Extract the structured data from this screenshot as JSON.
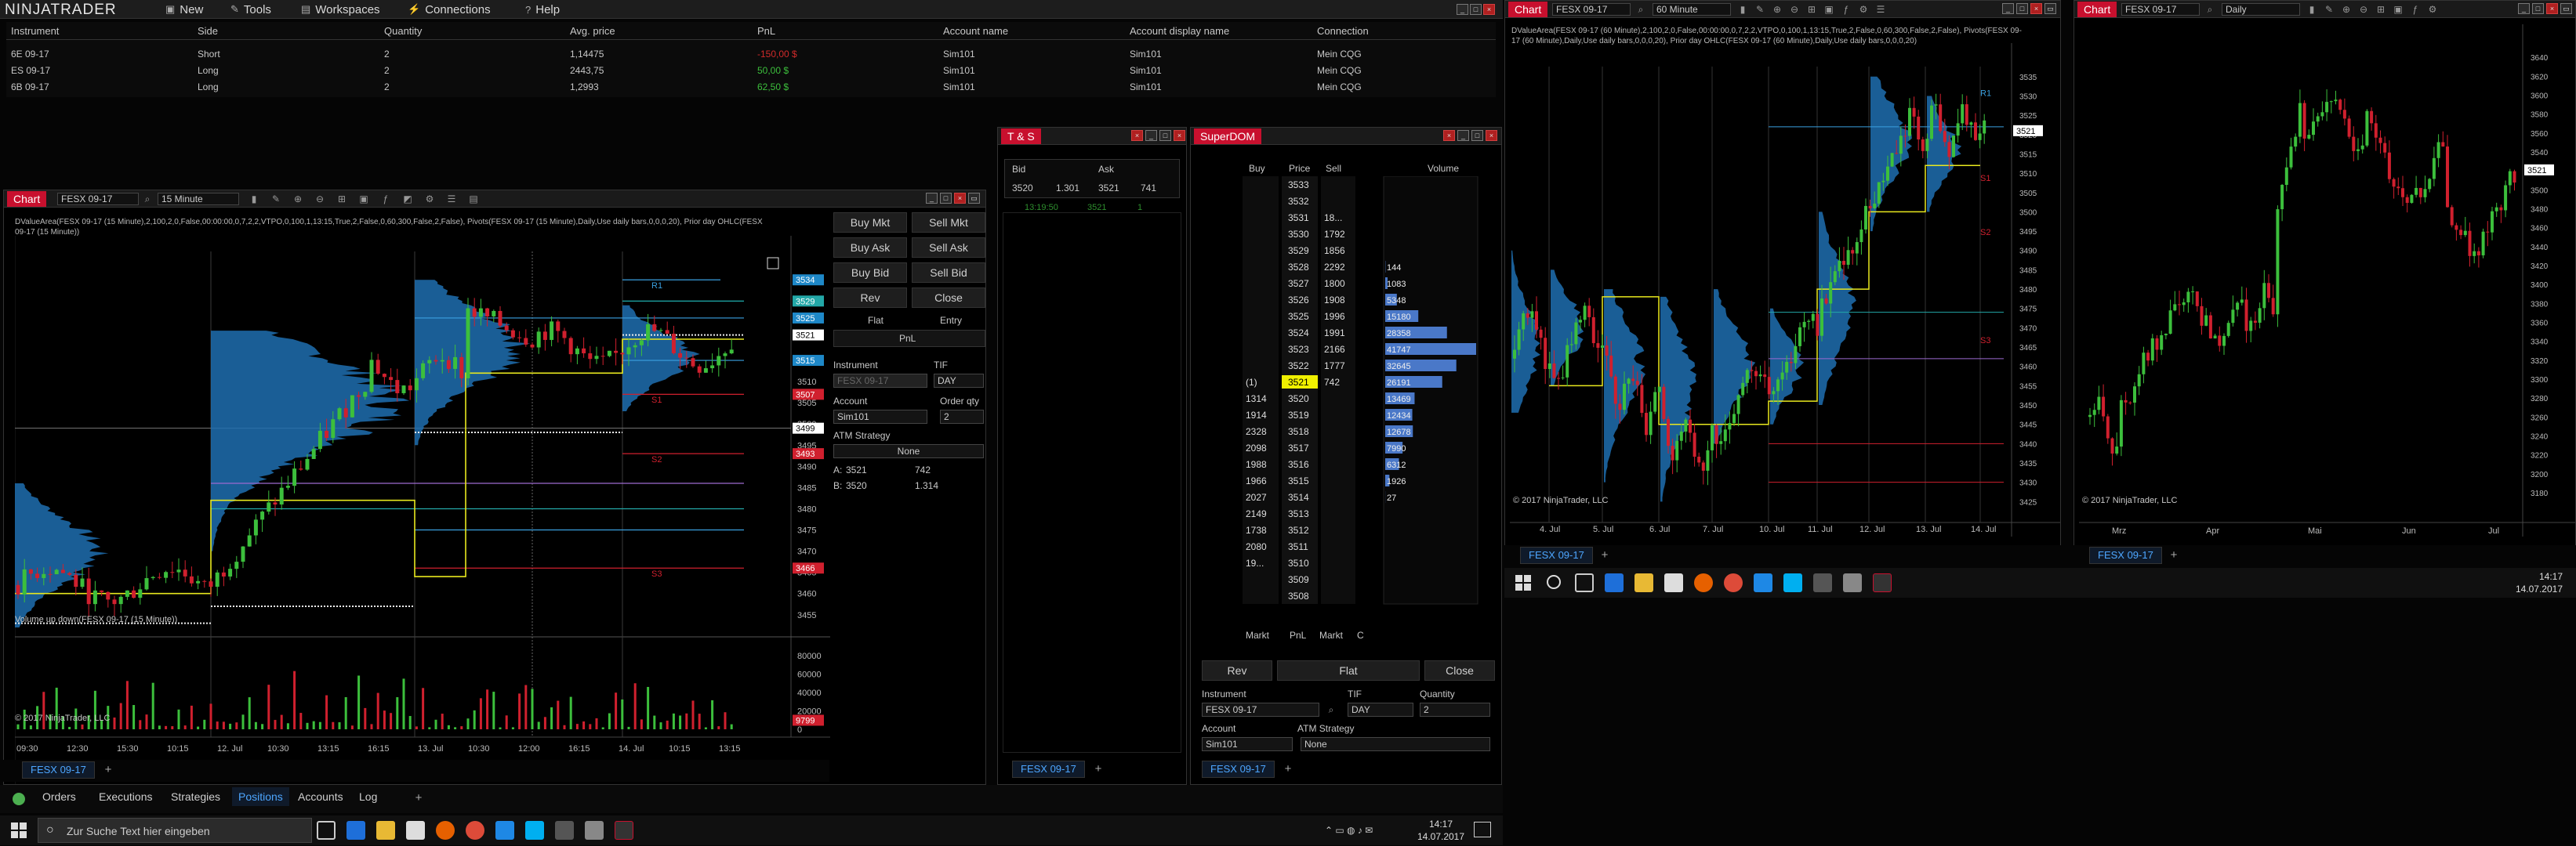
{
  "app": {
    "logo": "NINJATRADER"
  },
  "menu": {
    "items": [
      "New",
      "Tools",
      "Workspaces",
      "Connections",
      "Help"
    ]
  },
  "positions": {
    "columns": [
      "Instrument",
      "Side",
      "Quantity",
      "Avg. price",
      "PnL",
      "Account name",
      "Account display name",
      "Connection"
    ],
    "rows": [
      {
        "instrument": "6E 09-17",
        "side": "Short",
        "qty": "2",
        "avg": "1,14475",
        "pnl": "-150,00 $",
        "account": "Sim101",
        "display": "Sim101",
        "conn": "Mein CQG"
      },
      {
        "instrument": "ES 09-17",
        "side": "Long",
        "qty": "2",
        "avg": "2443,75",
        "pnl": "50,00 $",
        "account": "Sim101",
        "display": "Sim101",
        "conn": "Mein CQG"
      },
      {
        "instrument": "6B 09-17",
        "side": "Long",
        "qty": "2",
        "avg": "1,2993",
        "pnl": "62,50 $",
        "account": "Sim101",
        "display": "Sim101",
        "conn": "Mein CQG"
      }
    ]
  },
  "chart_main": {
    "title": "Chart",
    "instrument": "FESX 09-17",
    "interval": "15 Minute",
    "indicator_text": "DValueArea(FESX 09-17 (15 Minute),2,100,2,0,False,00:00:00,0,7,2,2,VTPO,0,100,1,13:15,True,2,False,0,60,300,False,2,False), Pivots(FESX 09-17 (15 Minute),Daily,Use daily bars,0,0,0,20), Prior day OHLC(FESX 09-17 (15 Minute))",
    "volume_label": "Volume up down(FESX 09-17 (15 Minute))",
    "copyright": "© 2017 NinjaTrader, LLC",
    "price_ticks": [
      "3515",
      "3510",
      "3505",
      "3500",
      "3495",
      "3490",
      "3485",
      "3480",
      "3475",
      "3470",
      "3465",
      "3460",
      "3455"
    ],
    "price_tags": [
      {
        "label": "3534",
        "color": "#1e88c8"
      },
      {
        "label": "3529",
        "color": "#23a8a8"
      },
      {
        "label": "3525",
        "color": "#1e88c8"
      },
      {
        "label": "3521",
        "color": "#ffffff"
      },
      {
        "label": "3515",
        "color": "#1e88c8"
      },
      {
        "label": "3507",
        "color": "#d0202e"
      },
      {
        "label": "3499",
        "color": "#ffffff"
      },
      {
        "label": "3493",
        "color": "#d0202e"
      },
      {
        "label": "3466",
        "color": "#d0202e"
      }
    ],
    "pivot_labels": [
      "R1",
      "S1",
      "S2",
      "S3"
    ],
    "vol_ticks": [
      "80000",
      "60000",
      "40000",
      "20000",
      "0"
    ],
    "vol_tag": "9799",
    "time_ticks": [
      "09:30",
      "12:30",
      "15:30",
      "10:15",
      "12. Jul",
      "10:30",
      "13:15",
      "16:15",
      "13. Jul",
      "10:30",
      "12:00",
      "16:15",
      "14. Jul",
      "10:15",
      "13:15"
    ],
    "tab": "FESX 09-17"
  },
  "chart_trader": {
    "buy_mkt": "Buy Mkt",
    "sell_mkt": "Sell Mkt",
    "buy_ask": "Buy Ask",
    "sell_ask": "Sell Ask",
    "buy_bid": "Buy Bid",
    "sell_bid": "Sell Bid",
    "rev": "Rev",
    "close": "Close",
    "flat": "Flat",
    "entry": "Entry",
    "pnl": "PnL",
    "instrument_label": "Instrument",
    "instrument_value": "FESX 09-17",
    "tif_label": "TIF",
    "tif_value": "DAY",
    "account_label": "Account",
    "account_value": "Sim101",
    "order_qty_label": "Order qty",
    "order_qty_value": "2",
    "atm_label": "ATM Strategy",
    "atm_value": "None",
    "ask_line_label": "A:",
    "ask_price": "3521",
    "ask_size": "742",
    "bid_line_label": "B:",
    "bid_price": "3520",
    "bid_size": "1.314"
  },
  "ts": {
    "title": "T & S",
    "bid_label": "Bid",
    "ask_label": "Ask",
    "bid_price": "3520",
    "bid_size": "1.301",
    "ask_price": "3521",
    "ask_size": "741",
    "trade_time": "13:19:50",
    "trade_price": "3521",
    "trade_size": "1",
    "tab": "FESX 09-17"
  },
  "superdom": {
    "title": "SuperDOM",
    "col_buy": "Buy",
    "col_price": "Price",
    "col_sell": "Sell",
    "col_volume": "Volume",
    "prices": [
      "3533",
      "3532",
      "3531",
      "3530",
      "3529",
      "3528",
      "3527",
      "3526",
      "3525",
      "3524",
      "3523",
      "3522",
      "3521",
      "3520",
      "3519",
      "3518",
      "3517",
      "3516",
      "3515",
      "3514",
      "3513",
      "3512",
      "3511",
      "3510",
      "3509",
      "3508"
    ],
    "sells": [
      "",
      "",
      "18...",
      "1792",
      "1856",
      "2292",
      "1800",
      "1908",
      "1996",
      "1991",
      "2166",
      "1777",
      "742",
      "",
      "",
      "",
      "",
      "",
      "",
      "",
      "",
      "",
      "",
      "",
      "",
      ""
    ],
    "buys": [
      "",
      "",
      "",
      "",
      "",
      "",
      "",
      "",
      "",
      "",
      "",
      "",
      "(1)",
      "1314",
      "1914",
      "2328",
      "2098",
      "1988",
      "1966",
      "2027",
      "2149",
      "1738",
      "2080",
      "19...",
      "",
      ""
    ],
    "volumes": [
      "",
      "",
      "",
      "",
      "",
      "144",
      "1083",
      "5348",
      "15180",
      "28358",
      "41747",
      "32645",
      "26191",
      "13469",
      "12434",
      "12678",
      "7990",
      "6312",
      "1926",
      "27",
      "",
      "",
      "",
      "",
      "",
      ""
    ],
    "vol_fracs": [
      0,
      0,
      0,
      0,
      0,
      0.003,
      0.026,
      0.128,
      0.364,
      0.679,
      1.0,
      0.782,
      0.627,
      0.323,
      0.298,
      0.304,
      0.191,
      0.151,
      0.046,
      0.001,
      0,
      0,
      0,
      0,
      0,
      0
    ],
    "last_price": "3521",
    "footer_markt_left": "Markt",
    "footer_pnl": "PnL",
    "footer_markt_right": "Markt",
    "footer_c": "C",
    "rev": "Rev",
    "flat": "Flat",
    "close": "Close",
    "instrument_label": "Instrument",
    "instrument_value": "FESX 09-17",
    "tif_label": "TIF",
    "tif_value": "DAY",
    "qty_label": "Quantity",
    "qty_value": "2",
    "account_label": "Account",
    "account_value": "Sim101",
    "atm_label": "ATM Strategy",
    "atm_value": "None",
    "tab": "FESX 09-17"
  },
  "chart_60": {
    "title": "Chart",
    "instrument": "FESX 09-17",
    "interval": "60 Minute",
    "indicator_text": "DValueArea(FESX 09-17 (60 Minute),2,100,2,0,False,00:00:00,0,7,2,2,VTPO,0,100,1,13:15,True,2,False,0,60,300,False,2,False), Pivots(FESX 09-17 (60 Minute),Daily,Use daily bars,0,0,0,20), Prior day OHLC(FESX 09-17 (60 Minute),Daily,Use daily bars,0,0,0,20)",
    "copyright": "© 2017 NinjaTrader, LLC",
    "price_ticks": [
      "3535",
      "3530",
      "3525",
      "3520",
      "3515",
      "3510",
      "3505",
      "3500",
      "3495",
      "3490",
      "3485",
      "3480",
      "3475",
      "3470",
      "3465",
      "3460",
      "3455",
      "3450",
      "3445",
      "3440",
      "3435",
      "3430",
      "3425"
    ],
    "last_tag": "3521",
    "pivot_labels": [
      "R1",
      "S1",
      "S2",
      "S3"
    ],
    "time_ticks": [
      "4. Jul",
      "5. Jul",
      "6. Jul",
      "7. Jul",
      "10. Jul",
      "11. Jul",
      "12. Jul",
      "13. Jul",
      "14. Jul"
    ],
    "tab": "FESX 09-17"
  },
  "chart_daily": {
    "title": "Chart",
    "instrument": "FESX 09-17",
    "interval": "Daily",
    "copyright": "© 2017 NinjaTrader, LLC",
    "price_ticks": [
      "3640",
      "3620",
      "3600",
      "3580",
      "3560",
      "3540",
      "3520",
      "3500",
      "3480",
      "3460",
      "3440",
      "3420",
      "3400",
      "3380",
      "3360",
      "3340",
      "3320",
      "3300",
      "3280",
      "3260",
      "3240",
      "3220",
      "3200",
      "3180"
    ],
    "last_tag": "3521",
    "time_ticks": [
      "Mrz",
      "Apr",
      "Mai",
      "Jun",
      "Jul"
    ],
    "tab": "FESX 09-17"
  },
  "bottom_tabs": [
    "Orders",
    "Executions",
    "Strategies",
    "Positions",
    "Accounts",
    "Log"
  ],
  "taskbar": {
    "search_placeholder": "Zur Suche Text hier eingeben",
    "time": "14:17",
    "date": "14.07.2017"
  },
  "taskbar2": {
    "time": "14:17",
    "date": "14.07.2017"
  },
  "colors": {
    "accent": "#c8102e",
    "tab_blue": "#4da6ff",
    "profile_blue": "#1f6fb0",
    "yellow": "#e8e81e",
    "red": "#d0202e"
  }
}
